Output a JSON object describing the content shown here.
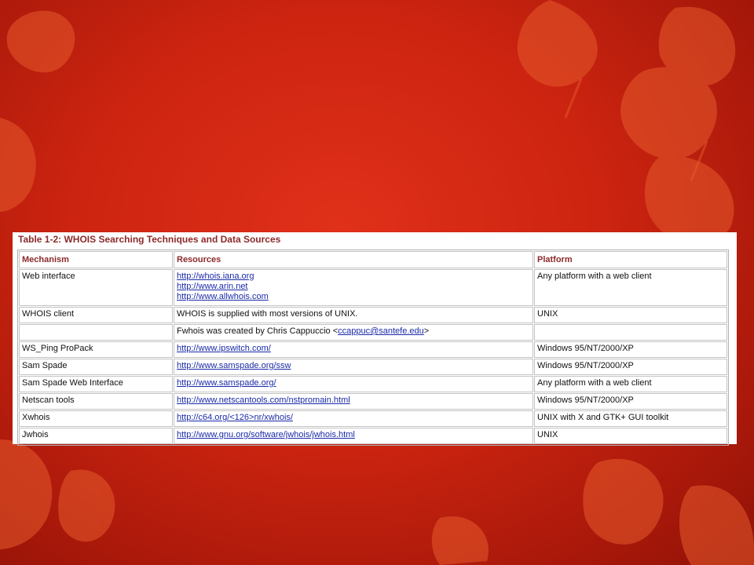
{
  "table": {
    "title": "Table 1-2: WHOIS Searching Techniques and Data Sources",
    "headers": [
      "Mechanism",
      "Resources",
      "Platform"
    ],
    "rows": [
      {
        "mechanism": "Web interface",
        "links": [
          "http://whois.iana.org",
          "http://www.arin.net",
          "http://www.allwhois.com"
        ],
        "platform": "Any platform with a web client"
      },
      {
        "mechanism": "WHOIS client",
        "text": "WHOIS is supplied with most versions of UNIX.",
        "platform": "UNIX"
      },
      {
        "mechanism": "",
        "text_before": "Fwhois was created by Chris Cappuccio <",
        "email": "ccappuc@santefe.edu",
        "text_after": ">",
        "platform": ""
      },
      {
        "mechanism": "WS_Ping ProPack",
        "links": [
          "http://www.ipswitch.com/"
        ],
        "platform": "Windows 95/NT/2000/XP"
      },
      {
        "mechanism": "Sam Spade",
        "links": [
          "http://www.samspade.org/ssw"
        ],
        "platform": "Windows 95/NT/2000/XP"
      },
      {
        "mechanism": "Sam Spade Web Interface",
        "links": [
          "http://www.samspade.org/"
        ],
        "platform": "Any platform with a web client"
      },
      {
        "mechanism": "Netscan tools",
        "links": [
          "http://www.netscantools.com/nstpromain.html"
        ],
        "platform": "Windows 95/NT/2000/XP"
      },
      {
        "mechanism": "Xwhois",
        "links": [
          "http://c64.org/<126>nr/xwhois/"
        ],
        "platform": "UNIX with X and GTK+ GUI toolkit"
      },
      {
        "mechanism": "Jwhois",
        "links": [
          "http://www.gnu.org/software/jwhois/jwhois.html"
        ],
        "platform": "UNIX"
      }
    ]
  },
  "colors": {
    "background": "#cc2410",
    "leaf": "#e86a3a",
    "header_text": "#8c2a2a",
    "link": "#1a2aa8"
  }
}
